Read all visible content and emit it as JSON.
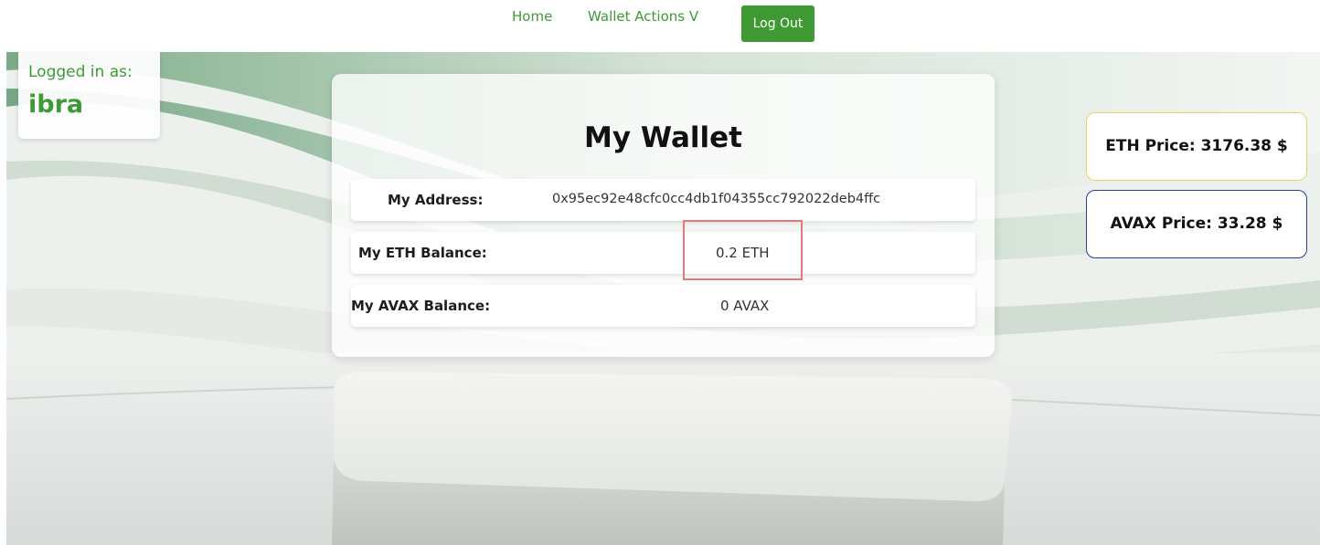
{
  "nav": {
    "home_label": "Home",
    "wallet_actions_label": "Wallet Actions V",
    "logout_label": "Log Out"
  },
  "user": {
    "label": "Logged in as:",
    "name": "ibra"
  },
  "wallet": {
    "title": "My Wallet",
    "rows": [
      {
        "label": "My Address:",
        "value": "0x95ec92e48cfc0cc4db1f04355cc792022deb4ffc"
      },
      {
        "label": "My ETH Balance:",
        "value": "0.2 ETH"
      },
      {
        "label": "My AVAX Balance:",
        "value": "0 AVAX"
      }
    ]
  },
  "prices": {
    "eth": "ETH Price: 3176.38 $",
    "avax": "AVAX Price: 33.28 $"
  },
  "colors": {
    "accent_green": "#3f9a34",
    "eth_border": "#f0d15c",
    "avax_border": "#2c3d8f",
    "highlight": "#e37a7a"
  }
}
